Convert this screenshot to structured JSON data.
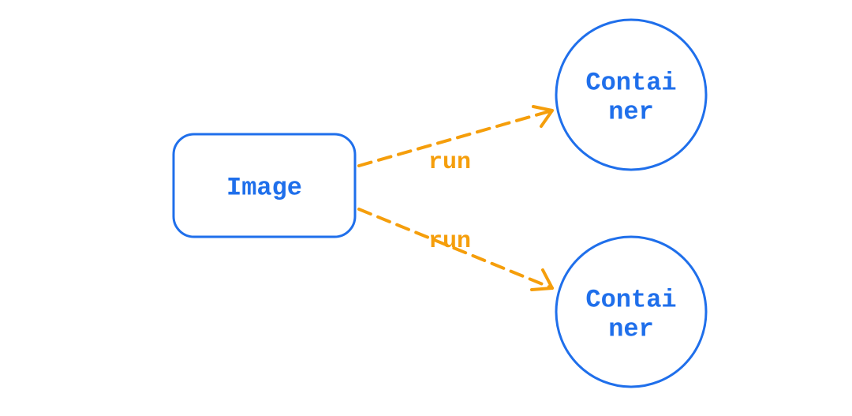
{
  "diagram": {
    "source_node": {
      "label": "Image"
    },
    "target_nodes": [
      {
        "line1": "Contai",
        "line2": "ner"
      },
      {
        "line1": "Contai",
        "line2": "ner"
      }
    ],
    "edges": [
      {
        "label": "run"
      },
      {
        "label": "run"
      }
    ]
  },
  "colors": {
    "node_stroke": "#1f6feb",
    "node_text": "#1f6feb",
    "edge": "#f59e0b",
    "edge_text": "#f59e0b"
  }
}
